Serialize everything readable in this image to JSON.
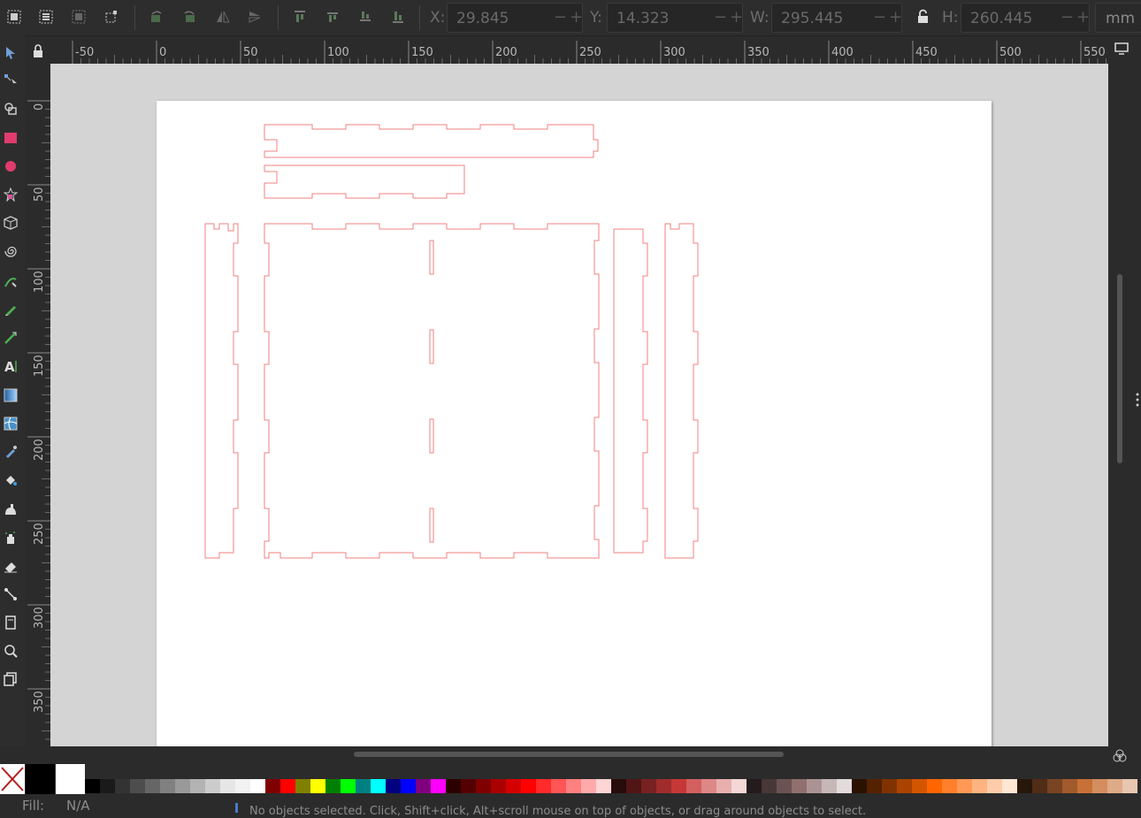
{
  "toolbar": {
    "x_label": "X:",
    "x_value": "29.845",
    "y_label": "Y:",
    "y_value": "14.323",
    "w_label": "W:",
    "w_value": "295.445",
    "h_label": "H:",
    "h_value": "260.445",
    "unit": "mm",
    "minus": "−",
    "plus": "+"
  },
  "rulers": {
    "horizontal": [
      "-50",
      "0",
      "50",
      "100",
      "150",
      "200",
      "250",
      "300",
      "350",
      "400",
      "450",
      "500",
      "550"
    ],
    "vertical": [
      "0",
      "50",
      "100",
      "150",
      "200",
      "250",
      "300",
      "350"
    ]
  },
  "status": {
    "fill_label": "Fill:",
    "fill_value": "N/A",
    "message": "No objects selected. Click, Shift+click, Alt+scroll mouse on top of objects, or drag around objects to select."
  },
  "palette": {
    "row": [
      "#000000",
      "#1a1a1a",
      "#333333",
      "#4d4d4d",
      "#666666",
      "#808080",
      "#999999",
      "#b3b3b3",
      "#cccccc",
      "#e6e6e6",
      "#f2f2f2",
      "#ffffff",
      "#800000",
      "#ff0000",
      "#808000",
      "#ffff00",
      "#008000",
      "#00ff00",
      "#008080",
      "#00ffff",
      "#000080",
      "#0000ff",
      "#800080",
      "#ff00ff",
      "#2b0000",
      "#550000",
      "#800000",
      "#aa0000",
      "#d40000",
      "#ff0000",
      "#ff2a2a",
      "#ff5555",
      "#ff8080",
      "#ffaaaa",
      "#ffd5d5",
      "#280b0b",
      "#501616",
      "#782121",
      "#a02c2c",
      "#c83737",
      "#d35f5f",
      "#de8787",
      "#e9afaf",
      "#f4d7d7",
      "#241c1c",
      "#483737",
      "#6c5353",
      "#916f6f",
      "#ac9393",
      "#c8b7b7",
      "#e3dbdb",
      "#2b1100",
      "#552200",
      "#803300",
      "#aa4400",
      "#d45500",
      "#ff6600",
      "#ff7f2a",
      "#ff9955",
      "#ffb380",
      "#ffccaa",
      "#ffe6d5",
      "#28170b",
      "#502d16",
      "#784421",
      "#a05a2c",
      "#c87137",
      "#d38d5f",
      "#deaa87",
      "#e9c6af"
    ]
  },
  "colors": {
    "shape_stroke": "#f08080",
    "canvas_bg": "#d4d4d4",
    "page_bg": "#ffffff",
    "ui_bg": "#2d2d2d"
  }
}
